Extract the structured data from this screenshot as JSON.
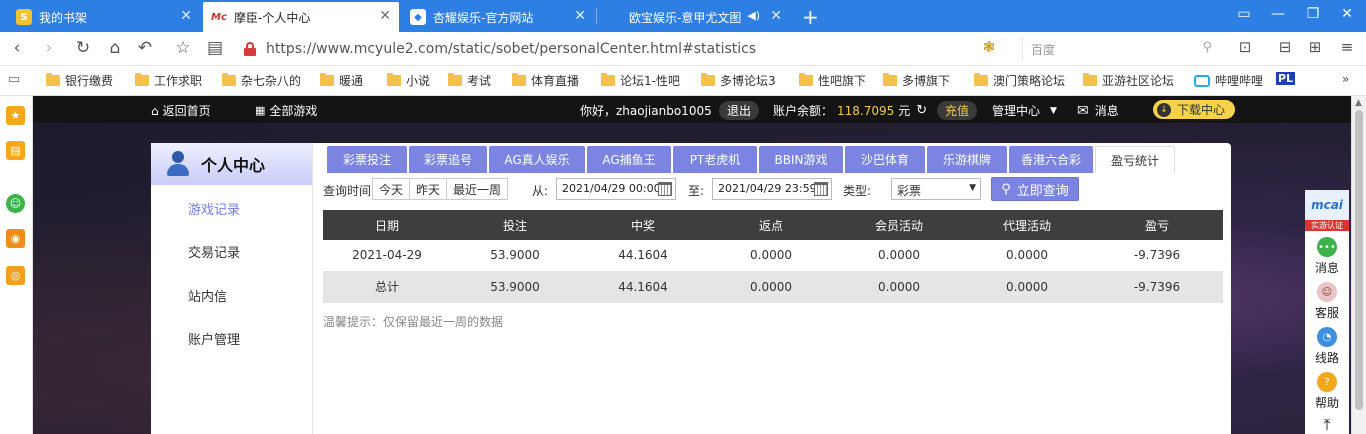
{
  "browser": {
    "tabs": [
      {
        "title": "我的书架",
        "active": false,
        "icon": "bookshelf-icon"
      },
      {
        "title": "摩臣-个人中心",
        "active": true,
        "icon": "mochen-logo-icon"
      },
      {
        "title": "杏耀娱乐-官方网站",
        "active": false,
        "icon": "shield-icon"
      },
      {
        "title": "欧宝娱乐-意甲尤文图",
        "active": false,
        "icon": "speaker-icon"
      }
    ],
    "url": "https://www.mcyule2.com/static/sobet/personalCenter.html#statistics",
    "search_placeholder": "百度",
    "bookmarks": [
      "银行缴费",
      "工作求职",
      "杂七杂八的",
      "暖通",
      "小说",
      "考试",
      "体育直播",
      "论坛1-性吧",
      "多博论坛3",
      "性吧旗下",
      "多博旗下",
      "澳门策略论坛",
      "亚游社区论坛",
      "哔哩哔哩",
      "PL"
    ]
  },
  "site": {
    "topnav": {
      "home": "返回首页",
      "all_games": "全部游戏",
      "greeting": "你好，zhaojianbo1005",
      "logout": "退出",
      "balance_label": "账户余额：",
      "balance": "118.7095",
      "currency": "元",
      "recharge": "充值",
      "manage": "管理中心",
      "messages": "消息",
      "download": "下载中心"
    },
    "sidebar": {
      "title": "个人中心",
      "items": [
        "游戏记录",
        "交易记录",
        "站内信",
        "账户管理"
      ],
      "active_index": 0
    },
    "tabs": [
      "彩票投注",
      "彩票追号",
      "AG真人娱乐",
      "AG捕鱼王",
      "PT老虎机",
      "BBIN游戏",
      "沙巴体育",
      "乐游棋牌",
      "香港六合彩",
      "盈亏统计"
    ],
    "active_tab": 9,
    "filter": {
      "query_time_label": "查询时间",
      "quick": [
        "今天",
        "昨天",
        "最近一周"
      ],
      "from_label": "从:",
      "from_value": "2021/04/29 00:00",
      "to_label": "至:",
      "to_value": "2021/04/29 23:59",
      "type_label": "类型:",
      "type_value": "彩票",
      "query_button": "立即查询"
    },
    "table": {
      "headers": [
        "日期",
        "投注",
        "中奖",
        "返点",
        "会员活动",
        "代理活动",
        "盈亏"
      ],
      "rows": [
        [
          "2021-04-29",
          "53.9000",
          "44.1604",
          "0.0000",
          "0.0000",
          "0.0000",
          "-9.7396"
        ]
      ],
      "summary": [
        "总计",
        "53.9000",
        "44.1604",
        "0.0000",
        "0.0000",
        "0.0000",
        "-9.7396"
      ]
    },
    "tip": "温馨提示：仅保留最近一周的数据",
    "widget": {
      "logo": "mcai",
      "badge": "实游认证",
      "items": [
        "消息",
        "客服",
        "线路",
        "帮助"
      ]
    }
  }
}
